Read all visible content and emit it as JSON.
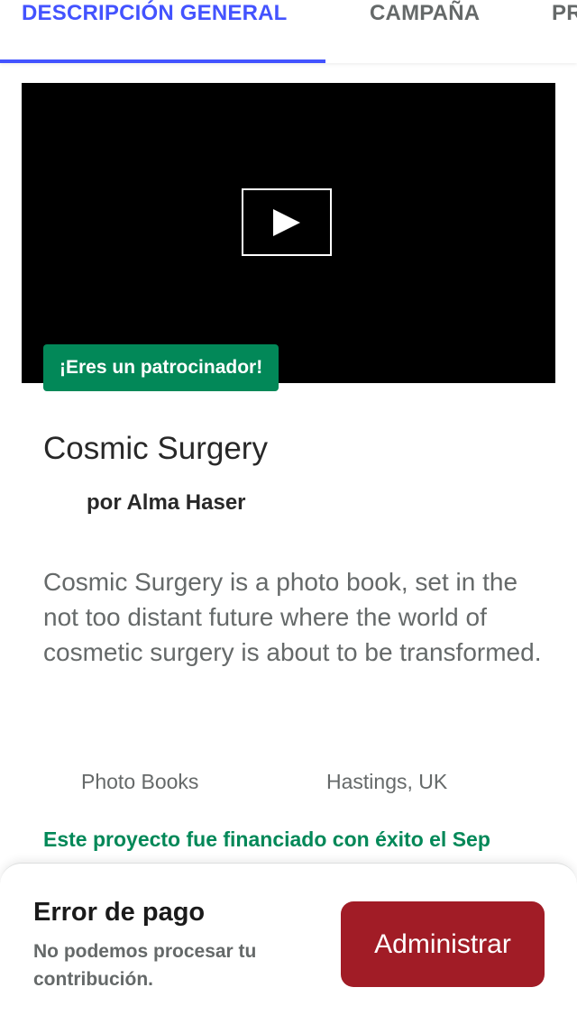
{
  "tabs": [
    {
      "label": "DESCRIPCIÓN GENERAL",
      "active": true
    },
    {
      "label": "CAMPAÑA",
      "active": false
    },
    {
      "label": "PR",
      "active": false
    }
  ],
  "colors": {
    "accent": "#4353ff",
    "success": "#028858",
    "danger": "#a11c26",
    "muted_text": "#656969"
  },
  "video": {
    "play_icon": "play-icon"
  },
  "badge": {
    "label": "¡Eres un patrocinador!"
  },
  "project": {
    "title": "Cosmic Surgery",
    "creator": "por Alma Haser",
    "blurb": "Cosmic Surgery is a photo book, set in the not too distant future where the world of cosmetic surgery is about to be transformed.",
    "category": "Photo Books",
    "location": "Hastings, UK",
    "funded_text": "Este proyecto fue financiado con éxito el Sep"
  },
  "payment_error": {
    "title": "Error de pago",
    "body": "No podemos procesar tu contribución.",
    "button_label": "Administrar"
  }
}
